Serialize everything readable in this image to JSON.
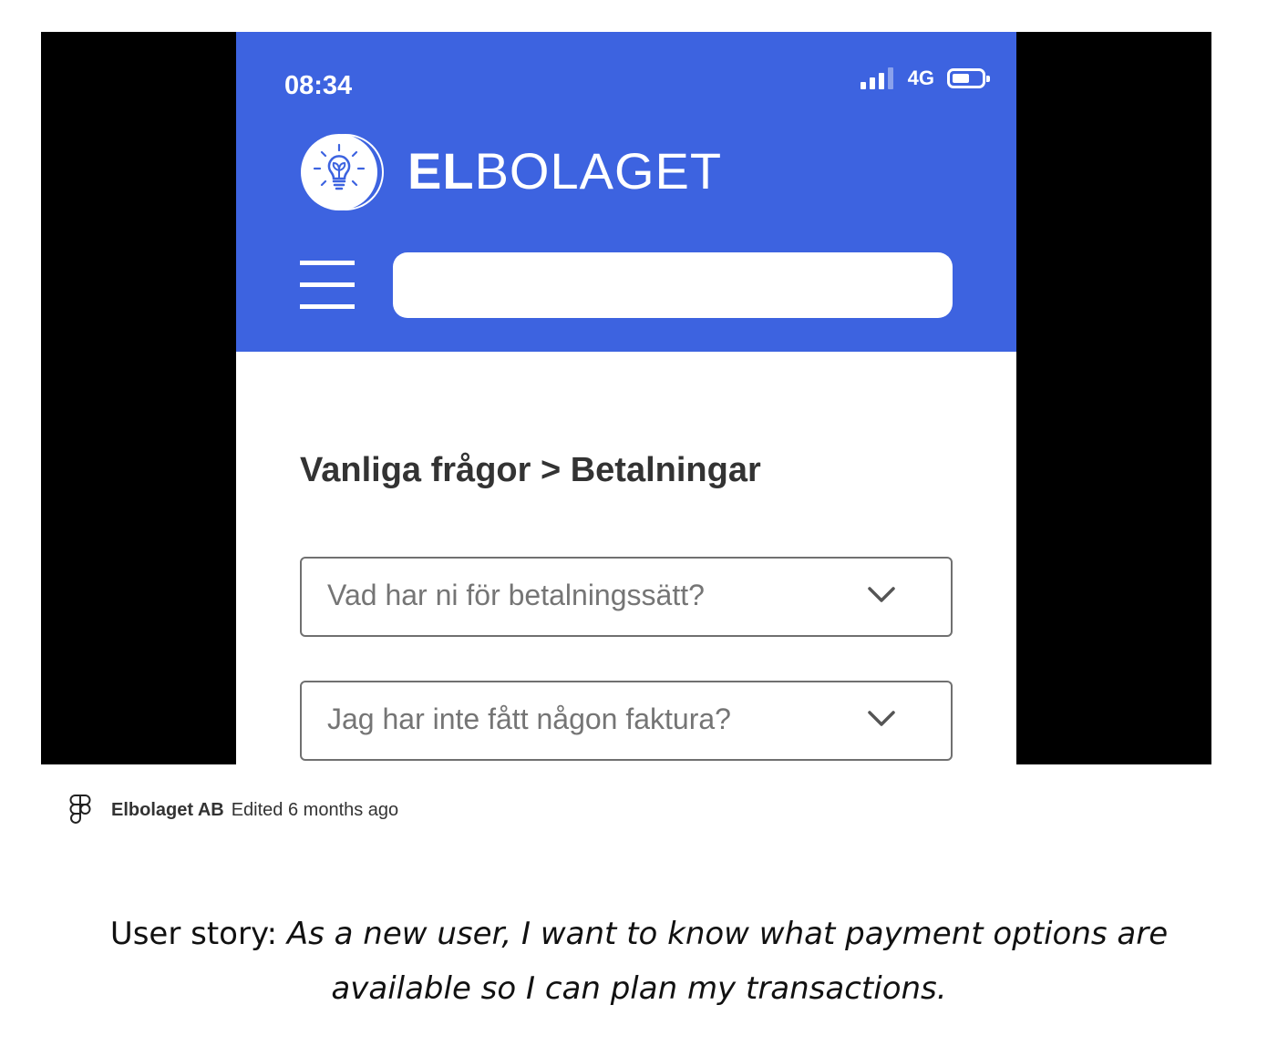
{
  "status_bar": {
    "time": "08:34",
    "network": "4G",
    "battery_level": 0.6,
    "signal_bars_active": 3,
    "signal_bars_total": 4
  },
  "brand": {
    "name_bold": "EL",
    "name_light": "BOLAGET",
    "logo_icon": "lightbulb-leaf-icon",
    "color": "#3d63e0"
  },
  "header": {
    "menu_icon": "hamburger-menu-icon",
    "search_value": ""
  },
  "breadcrumb": "Vanliga frågor > Betalningar",
  "faq_items": [
    {
      "question": "Vad har ni för betalningssätt?",
      "icon": "chevron-down-icon"
    },
    {
      "question": "Jag har inte fått någon faktura?",
      "icon": "chevron-down-icon"
    }
  ],
  "caption": {
    "icon": "figma-icon",
    "owner": "Elbolaget AB",
    "edited": "Edited 6 months ago"
  },
  "user_story": {
    "label": "User story: ",
    "text": "As a new user, I want to know what payment options are available so I can plan my transactions."
  }
}
